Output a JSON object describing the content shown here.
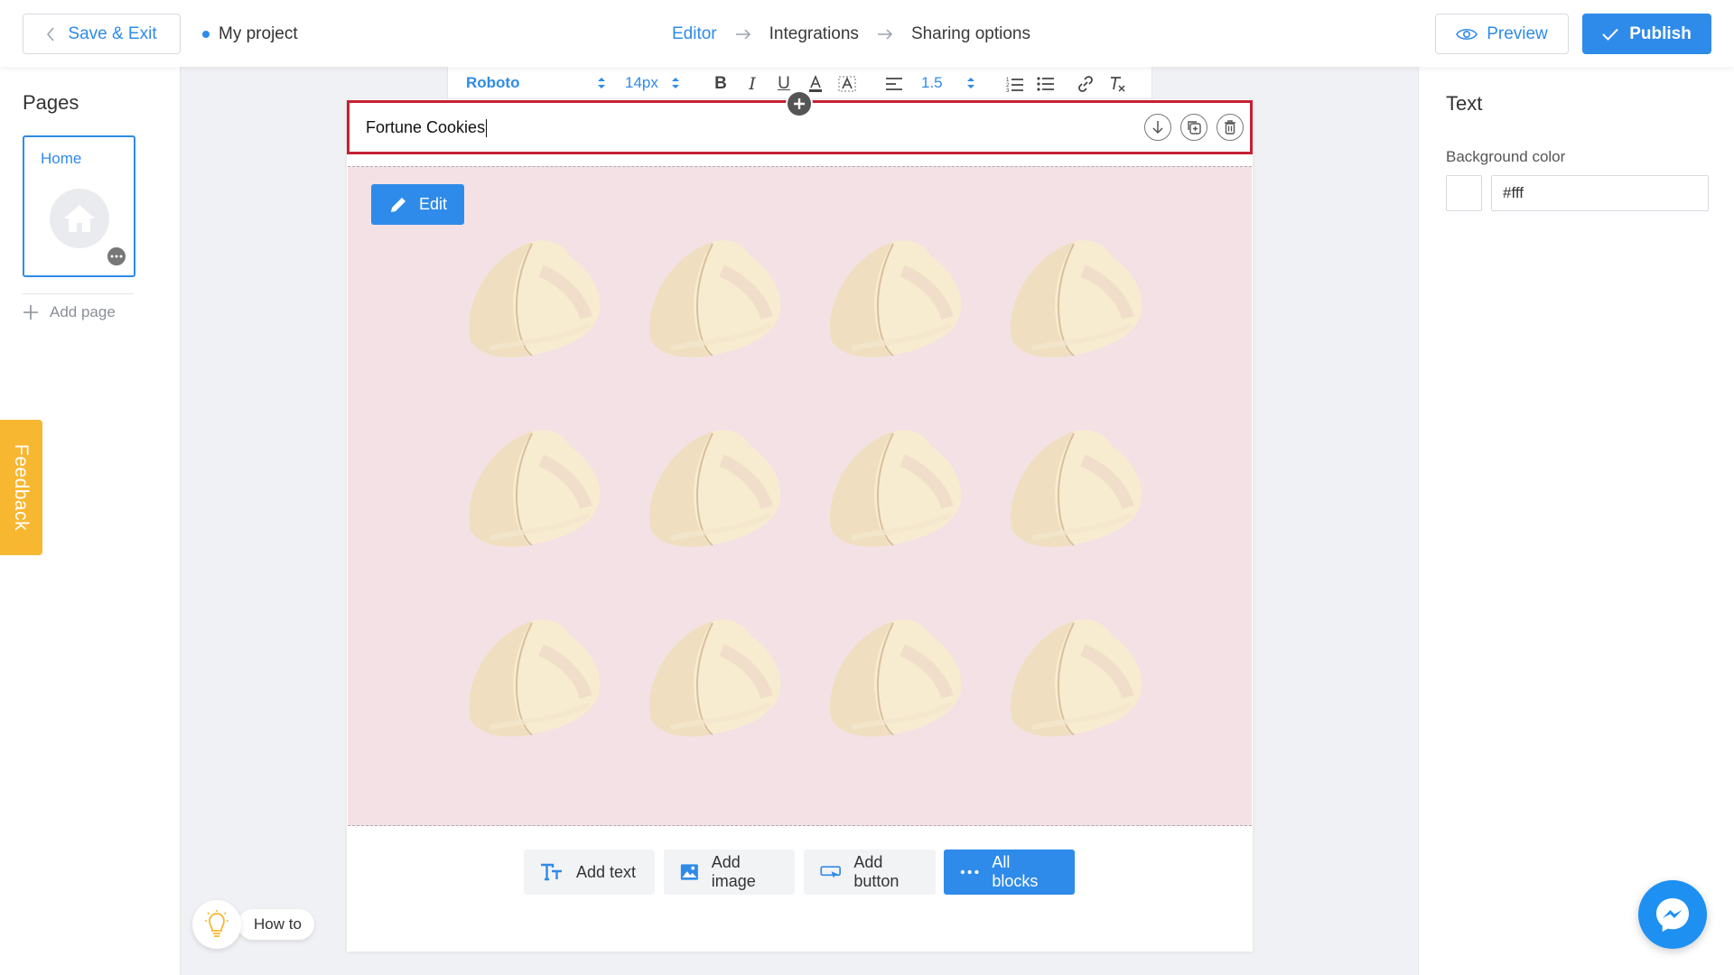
{
  "header": {
    "save_exit_label": "Save & Exit",
    "project_name": "My project",
    "steps": [
      {
        "label": "Editor",
        "active": true
      },
      {
        "label": "Integrations",
        "active": false
      },
      {
        "label": "Sharing options",
        "active": false
      }
    ],
    "preview_label": "Preview",
    "publish_label": "Publish"
  },
  "sidebar": {
    "title": "Pages",
    "pages": [
      {
        "label": "Home",
        "selected": true
      }
    ],
    "add_page_label": "Add page"
  },
  "feedback": {
    "label": "Feedback"
  },
  "toolbar": {
    "font_family": "Roboto",
    "font_size": "14px",
    "line_height": "1.5",
    "icons": [
      "bold-icon",
      "italic-icon",
      "underline-icon",
      "text-color-icon",
      "highlight-icon",
      "align-left-icon",
      "ordered-list-icon",
      "bullet-list-icon",
      "link-icon",
      "clear-format-icon"
    ]
  },
  "text_block": {
    "content": "Fortune Cookies",
    "actions": [
      "move-down-icon",
      "duplicate-icon",
      "delete-icon"
    ]
  },
  "image_block": {
    "edit_label": "Edit",
    "background_color": "#f4e1e5"
  },
  "add_blocks": {
    "add_text": "Add text",
    "add_image": "Add image",
    "add_button": "Add button",
    "all_blocks": "All blocks"
  },
  "properties": {
    "title": "Text",
    "background_label": "Background color",
    "background_value": "#fff"
  },
  "help": {
    "how_to_label": "How to"
  },
  "colors": {
    "accent": "#2f8be9",
    "selection_border": "#c62033",
    "feedback": "#f7b731",
    "messenger": "#1e90f2"
  }
}
